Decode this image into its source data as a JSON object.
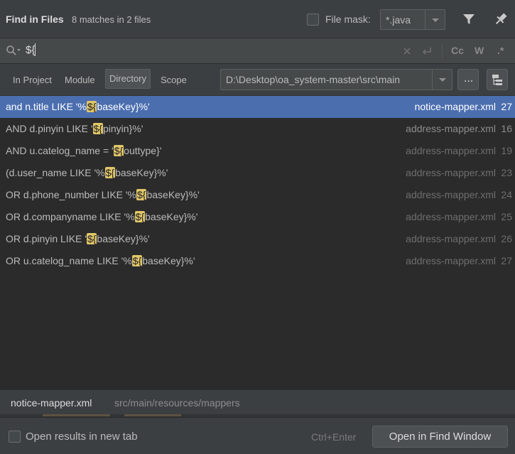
{
  "header": {
    "title": "Find in Files",
    "subtitle": "8 matches in 2 files",
    "file_mask_label": "File mask:",
    "file_mask_value": "*.java",
    "file_mask_checked": false,
    "filter_icon": "filter-icon",
    "pin_icon": "pin-icon"
  },
  "search": {
    "query": "${",
    "options": [
      "Cc",
      "W",
      ".*"
    ]
  },
  "scope": {
    "tabs": [
      "In Project",
      "Module",
      "Directory",
      "Scope"
    ],
    "active_tab": "Directory",
    "directory": "D:\\Desktop\\oa_system-master\\src\\main",
    "browse_label": "..."
  },
  "results": [
    {
      "before": "and n.title LIKE '%",
      "match": "${",
      "after": "baseKey}%'",
      "file": "notice-mapper.xml",
      "line": "27",
      "selected": true
    },
    {
      "before": "AND d.pinyin LIKE '",
      "match": "${",
      "after": "pinyin}%'",
      "file": "address-mapper.xml",
      "line": "16",
      "selected": false
    },
    {
      "before": "AND u.catelog_name = '",
      "match": "${",
      "after": "outtype}'",
      "file": "address-mapper.xml",
      "line": "19",
      "selected": false
    },
    {
      "before": "(d.user_name LIKE '%",
      "match": "${",
      "after": "baseKey}%'",
      "file": "address-mapper.xml",
      "line": "23",
      "selected": false
    },
    {
      "before": "OR d.phone_number LIKE '%",
      "match": "${",
      "after": "baseKey}%'",
      "file": "address-mapper.xml",
      "line": "24",
      "selected": false
    },
    {
      "before": "OR d.companyname LIKE '%",
      "match": "${",
      "after": "baseKey}%'",
      "file": "address-mapper.xml",
      "line": "25",
      "selected": false
    },
    {
      "before": "OR d.pinyin LIKE '",
      "match": "${",
      "after": "baseKey}%'",
      "file": "address-mapper.xml",
      "line": "26",
      "selected": false
    },
    {
      "before": "OR u.catelog_name LIKE '%",
      "match": "${",
      "after": "baseKey}%'",
      "file": "address-mapper.xml",
      "line": "27",
      "selected": false
    }
  ],
  "preview": {
    "file_name": "notice-mapper.xml",
    "file_path": "src/main/resources/mappers"
  },
  "footer": {
    "open_new_tab_label": "Open results in new tab",
    "open_new_tab_checked": false,
    "shortcut_hint": "Ctrl+Enter",
    "open_find_window_label": "Open in Find Window"
  }
}
